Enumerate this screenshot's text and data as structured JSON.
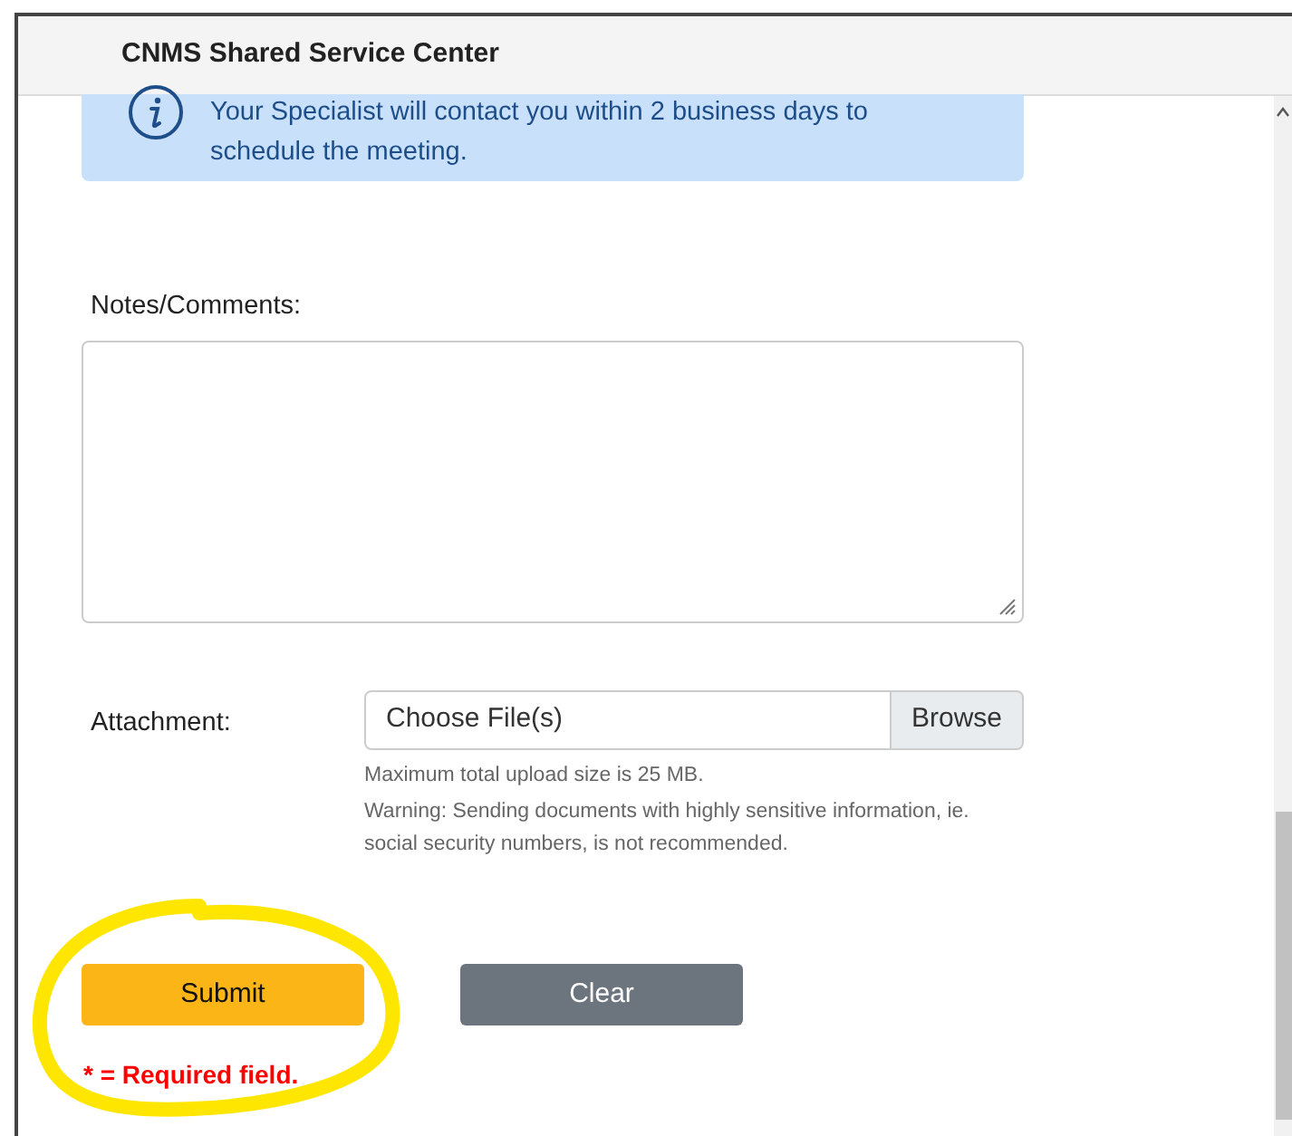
{
  "header": {
    "title": "CNMS Shared Service Center"
  },
  "info": {
    "text": "Your Specialist will contact you within 2 business days to schedule the meeting."
  },
  "notes": {
    "label": "Notes/Comments:"
  },
  "attachment": {
    "label": "Attachment:",
    "placeholder": "Choose File(s)",
    "browse": "Browse",
    "hints": [
      "Maximum total upload size is 25 MB.",
      "Warning: Sending documents with highly sensitive information, ie. social security numbers, is not recommended."
    ]
  },
  "buttons": [
    {
      "label": "Submit",
      "kind": "primary"
    },
    {
      "label": "Clear",
      "kind": "secondary"
    }
  ],
  "required_note": "* = Required field."
}
